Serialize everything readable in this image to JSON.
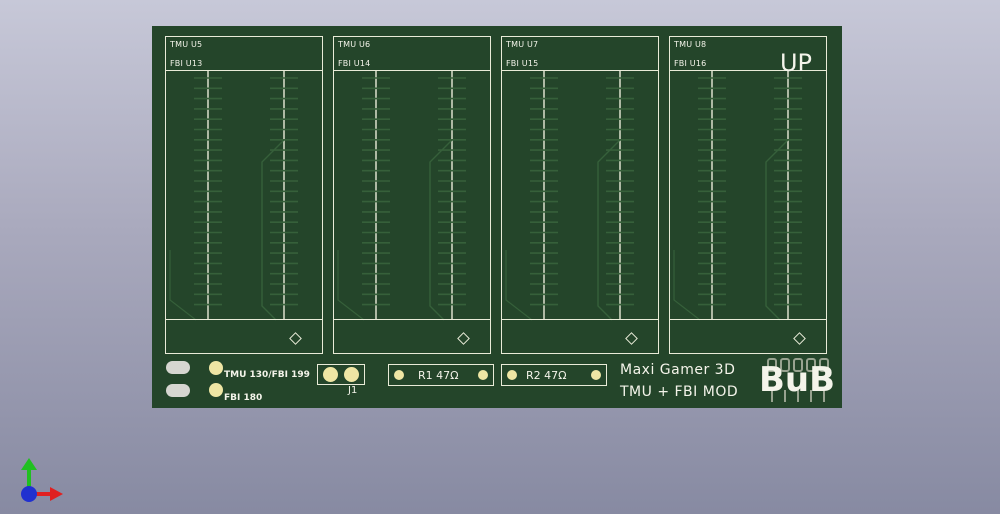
{
  "board": {
    "slots": [
      {
        "tmu": "TMU U5",
        "fbi": "FBI U13"
      },
      {
        "tmu": "TMU U6",
        "fbi": "FBI U14"
      },
      {
        "tmu": "TMU U7",
        "fbi": "FBI U15"
      },
      {
        "tmu": "TMU U8",
        "fbi": "FBI U16"
      }
    ],
    "up_label": "UP",
    "pad_label_1": "TMU 130/FBI 199",
    "pad_label_2": "FBI 180",
    "connector_label": "J1",
    "r1_label": "R1 47Ω",
    "r2_label": "R2 47Ω",
    "title_line1": "Maxi Gamer 3D",
    "title_line2": "TMU + FBI MOD",
    "logo_text": "BuB",
    "colors": {
      "board": "#24452a",
      "silkscreen": "#e9ebd8",
      "pad": "#efe6a4",
      "trace": "#36603a"
    }
  },
  "axis_gizmo": {
    "x_color": "#e02020",
    "y_color": "#20c020",
    "z_color": "#2030d0"
  }
}
